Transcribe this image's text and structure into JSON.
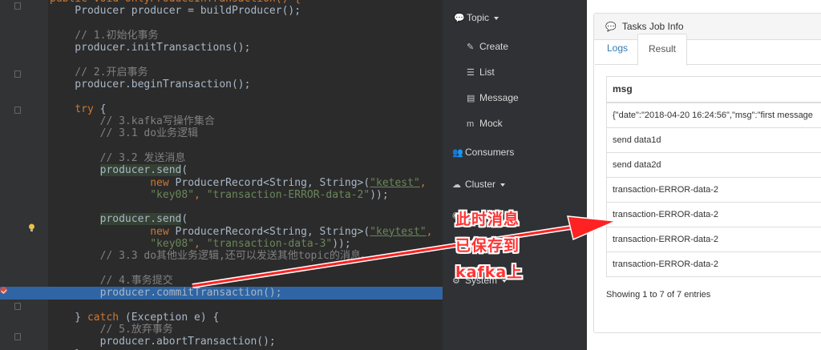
{
  "editor": {
    "lines": [
      {
        "parts": [
          {
            "t": "public void onlyProduceInTransaction() {",
            "c": "kw-cut"
          }
        ]
      },
      {
        "parts": [
          {
            "t": "    Producer producer = buildProducer();",
            "c": ""
          }
        ]
      },
      {
        "parts": [
          {
            "t": "",
            "c": ""
          }
        ]
      },
      {
        "parts": [
          {
            "t": "    // 1.初始化事务",
            "c": "cmt"
          }
        ]
      },
      {
        "parts": [
          {
            "t": "    producer.initTransactions();",
            "c": ""
          }
        ]
      },
      {
        "parts": [
          {
            "t": "",
            "c": ""
          }
        ]
      },
      {
        "parts": [
          {
            "t": "    // 2.开启事务",
            "c": "cmt"
          }
        ]
      },
      {
        "parts": [
          {
            "t": "    producer.beginTransaction();",
            "c": ""
          }
        ]
      },
      {
        "parts": [
          {
            "t": "",
            "c": ""
          }
        ]
      },
      {
        "parts": [
          {
            "t": "    ",
            "c": ""
          },
          {
            "t": "try",
            "c": "kw"
          },
          {
            "t": " {",
            "c": ""
          }
        ]
      },
      {
        "parts": [
          {
            "t": "        // 3.kafka写操作集合",
            "c": "cmt"
          }
        ]
      },
      {
        "parts": [
          {
            "t": "        // 3.1 do业务逻辑",
            "c": "cmt"
          }
        ]
      },
      {
        "parts": [
          {
            "t": "",
            "c": ""
          }
        ]
      },
      {
        "parts": [
          {
            "t": "        // 3.2 发送消息",
            "c": "cmt"
          }
        ]
      },
      {
        "parts": [
          {
            "t": "        ",
            "c": ""
          },
          {
            "t": "producer.send",
            "c": "hlcall"
          },
          {
            "t": "(",
            "c": ""
          }
        ]
      },
      {
        "parts": [
          {
            "t": "                ",
            "c": ""
          },
          {
            "t": "new",
            "c": "kw"
          },
          {
            "t": " ProducerRecord<String, String>(",
            "c": ""
          },
          {
            "t": "\"ketest\"",
            "c": "str u"
          },
          {
            "t": ",",
            "c": "kw"
          }
        ]
      },
      {
        "parts": [
          {
            "t": "                ",
            "c": ""
          },
          {
            "t": "\"key08\"",
            "c": "str"
          },
          {
            "t": ", ",
            "c": "kw"
          },
          {
            "t": "\"transaction-ERROR-data-2\"",
            "c": "str"
          },
          {
            "t": "));",
            "c": ""
          }
        ]
      },
      {
        "parts": [
          {
            "t": "",
            "c": ""
          }
        ]
      },
      {
        "parts": [
          {
            "t": "        ",
            "c": ""
          },
          {
            "t": "producer.send",
            "c": "hlcall"
          },
          {
            "t": "(",
            "c": ""
          }
        ]
      },
      {
        "parts": [
          {
            "t": "                ",
            "c": ""
          },
          {
            "t": "new",
            "c": "kw"
          },
          {
            "t": " ProducerRecord<String, String>(",
            "c": ""
          },
          {
            "t": "\"keytest\"",
            "c": "str u"
          },
          {
            "t": ",",
            "c": "kw"
          }
        ]
      },
      {
        "parts": [
          {
            "t": "                ",
            "c": ""
          },
          {
            "t": "\"key08\"",
            "c": "str"
          },
          {
            "t": ", ",
            "c": "kw"
          },
          {
            "t": "\"transaction-data-3\"",
            "c": "str"
          },
          {
            "t": "));",
            "c": ""
          }
        ]
      },
      {
        "parts": [
          {
            "t": "        // 3.3 do其他业务逻辑,还可以发送其他topic的消息。",
            "c": "cmt"
          }
        ]
      },
      {
        "parts": [
          {
            "t": "",
            "c": ""
          }
        ]
      },
      {
        "parts": [
          {
            "t": "        // 4.事务提交",
            "c": "cmt"
          }
        ]
      },
      {
        "parts": [
          {
            "t": "        producer.commitTransaction();",
            "c": ""
          }
        ],
        "highlight": true
      },
      {
        "parts": [
          {
            "t": "",
            "c": ""
          }
        ]
      },
      {
        "parts": [
          {
            "t": "    } ",
            "c": ""
          },
          {
            "t": "catch",
            "c": "kw"
          },
          {
            "t": " (Exception e) {",
            "c": ""
          }
        ]
      },
      {
        "parts": [
          {
            "t": "        // 5.放弃事务",
            "c": "cmt"
          }
        ]
      },
      {
        "parts": [
          {
            "t": "        producer.abortTransaction();",
            "c": ""
          }
        ]
      },
      {
        "parts": [
          {
            "t": "    }",
            "c": ""
          }
        ]
      }
    ]
  },
  "nav": {
    "items": [
      {
        "name": "nav-topic",
        "icon": "comments-icon",
        "glyph": "💬",
        "label": "Topic",
        "caret": true
      },
      {
        "name": "nav-topic-create",
        "icon": "edit-icon",
        "glyph": "✎",
        "label": "Create"
      },
      {
        "name": "nav-topic-list",
        "icon": "list-icon",
        "glyph": "☰",
        "label": "List"
      },
      {
        "name": "nav-topic-message",
        "icon": "file-icon",
        "glyph": "▤",
        "label": "Message"
      },
      {
        "name": "nav-topic-mock",
        "icon": "mock-icon",
        "glyph": "m",
        "label": "Mock"
      },
      {
        "name": "nav-consumers",
        "icon": "users-icon",
        "glyph": "👥",
        "label": "Consumers"
      },
      {
        "name": "nav-cluster",
        "icon": "cloud-icon",
        "glyph": "☁",
        "label": "Cluster",
        "caret": true
      },
      {
        "name": "nav-eye",
        "icon": "eye-icon",
        "glyph": "◉",
        "label": ""
      },
      {
        "name": "nav-system",
        "icon": "gear-icon",
        "glyph": "⚙",
        "label": "System",
        "caret": true
      }
    ]
  },
  "panel": {
    "title": "Tasks Job Info",
    "tabs": {
      "logs": "Logs",
      "result": "Result"
    },
    "table": {
      "header": "msg",
      "rows": [
        "{\"date\":\"2018-04-20 16:24:56\",\"msg\":\"first message",
        "send data1d",
        "send data2d",
        "transaction-ERROR-data-2",
        "transaction-ERROR-data-2",
        "transaction-ERROR-data-2",
        "transaction-ERROR-data-2"
      ]
    },
    "footer": "Showing 1 to 7 of 7 entries"
  },
  "annotation": {
    "lines": [
      "此时消息",
      "已保存到",
      "kafka上"
    ],
    "color": "#ff3333"
  },
  "colors": {
    "editor_bg": "#2b2b2b",
    "highlight_line": "#2f65a4",
    "keyword": "#cc7832",
    "comment": "#808080",
    "string": "#6a8759",
    "link": "#337ab7"
  }
}
